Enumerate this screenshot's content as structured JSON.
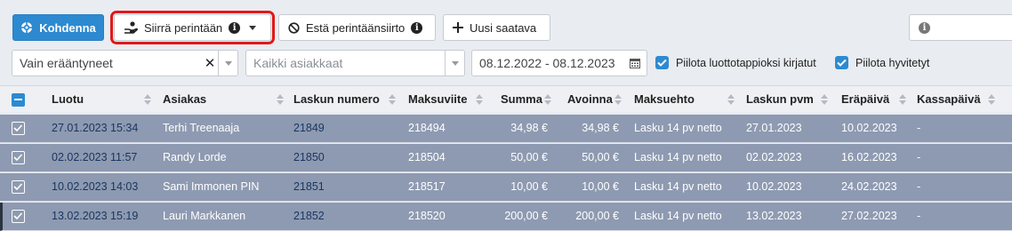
{
  "toolbar": {
    "allocate_label": "Kohdenna",
    "move_to_collection_label": "Siirrä perintään",
    "block_collection_label": "Estä perintäänsiirto",
    "new_receivable_label": "Uusi saatava"
  },
  "filters": {
    "due_filter_value": "Vain erääntyneet",
    "customer_placeholder": "Kaikki asiakkaat",
    "date_range_value": "08.12.2022 - 08.12.2023",
    "hide_credit_loss_label": "Piilota luottotappioksi kirjatut",
    "hide_credit_loss_checked": true,
    "hide_credited_label": "Piilota hyvitetyt",
    "hide_credited_checked": true
  },
  "table": {
    "headers": {
      "created": "Luotu",
      "customer": "Asiakas",
      "invoice_number": "Laskun numero",
      "reference": "Maksuviite",
      "amount": "Summa",
      "open": "Avoinna",
      "terms": "Maksuehto",
      "invoice_date": "Laskun pvm",
      "due_date": "Eräpäivä",
      "cash_date": "Kassapäivä"
    },
    "rows": [
      {
        "created": "27.01.2023 15:34",
        "customer": "Terhi Treenaaja",
        "invoice_number": "21849",
        "reference": "218494",
        "amount": "34,98 €",
        "open": "34,98 €",
        "terms": "Lasku 14 pv netto",
        "invoice_date": "27.01.2023",
        "due_date": "10.02.2023",
        "cash_date": "-",
        "checked": true
      },
      {
        "created": "02.02.2023 11:57",
        "customer": "Randy Lorde",
        "invoice_number": "21850",
        "reference": "218504",
        "amount": "50,00 €",
        "open": "50,00 €",
        "terms": "Lasku 14 pv netto",
        "invoice_date": "02.02.2023",
        "due_date": "16.02.2023",
        "cash_date": "-",
        "checked": true
      },
      {
        "created": "10.02.2023 14:03",
        "customer": "Sami Immonen PIN",
        "invoice_number": "21851",
        "reference": "218517",
        "amount": "10,00 €",
        "open": "10,00 €",
        "terms": "Lasku 14 pv netto",
        "invoice_date": "10.02.2023",
        "due_date": "24.02.2023",
        "cash_date": "-",
        "checked": true
      },
      {
        "created": "13.02.2023 15:19",
        "customer": "Lauri Markkanen",
        "invoice_number": "21852",
        "reference": "218520",
        "amount": "200,00 €",
        "open": "200,00 €",
        "terms": "Lasku 14 pv netto",
        "invoice_date": "13.02.2023",
        "due_date": "27.02.2023",
        "cash_date": "-",
        "checked": true
      }
    ]
  },
  "colors": {
    "primary": "#2d8ad0",
    "selected_row": "#8e9ab1",
    "highlight_outline": "#e01919"
  }
}
